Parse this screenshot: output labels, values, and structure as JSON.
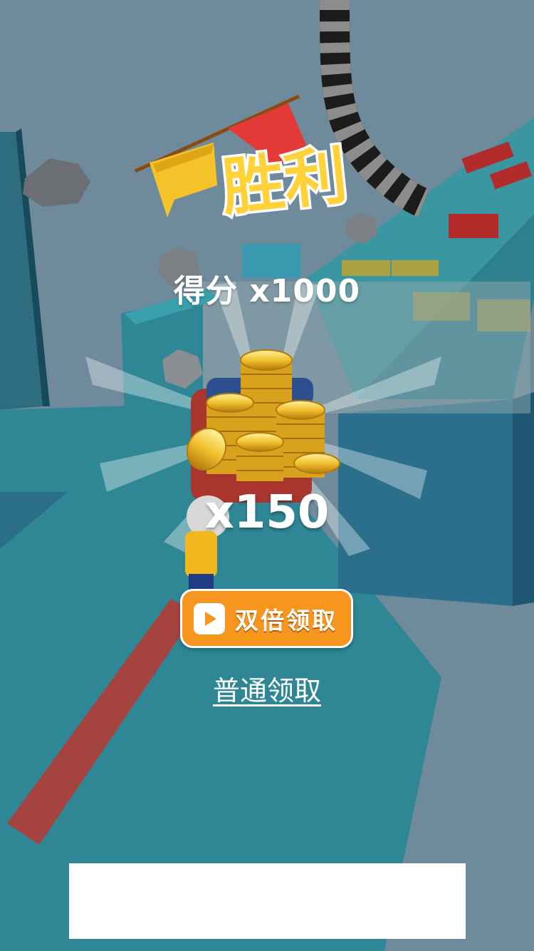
{
  "victory": {
    "title": "胜利"
  },
  "score": {
    "label": "得分",
    "multiplier": "x1000"
  },
  "reward": {
    "coin_count": "x150"
  },
  "buttons": {
    "double_claim": "双倍领取",
    "normal_claim": "普通领取"
  },
  "colors": {
    "button_orange": "#f6961e",
    "title_yellow": "#ffd23a",
    "title_outline": "#ffffff"
  }
}
